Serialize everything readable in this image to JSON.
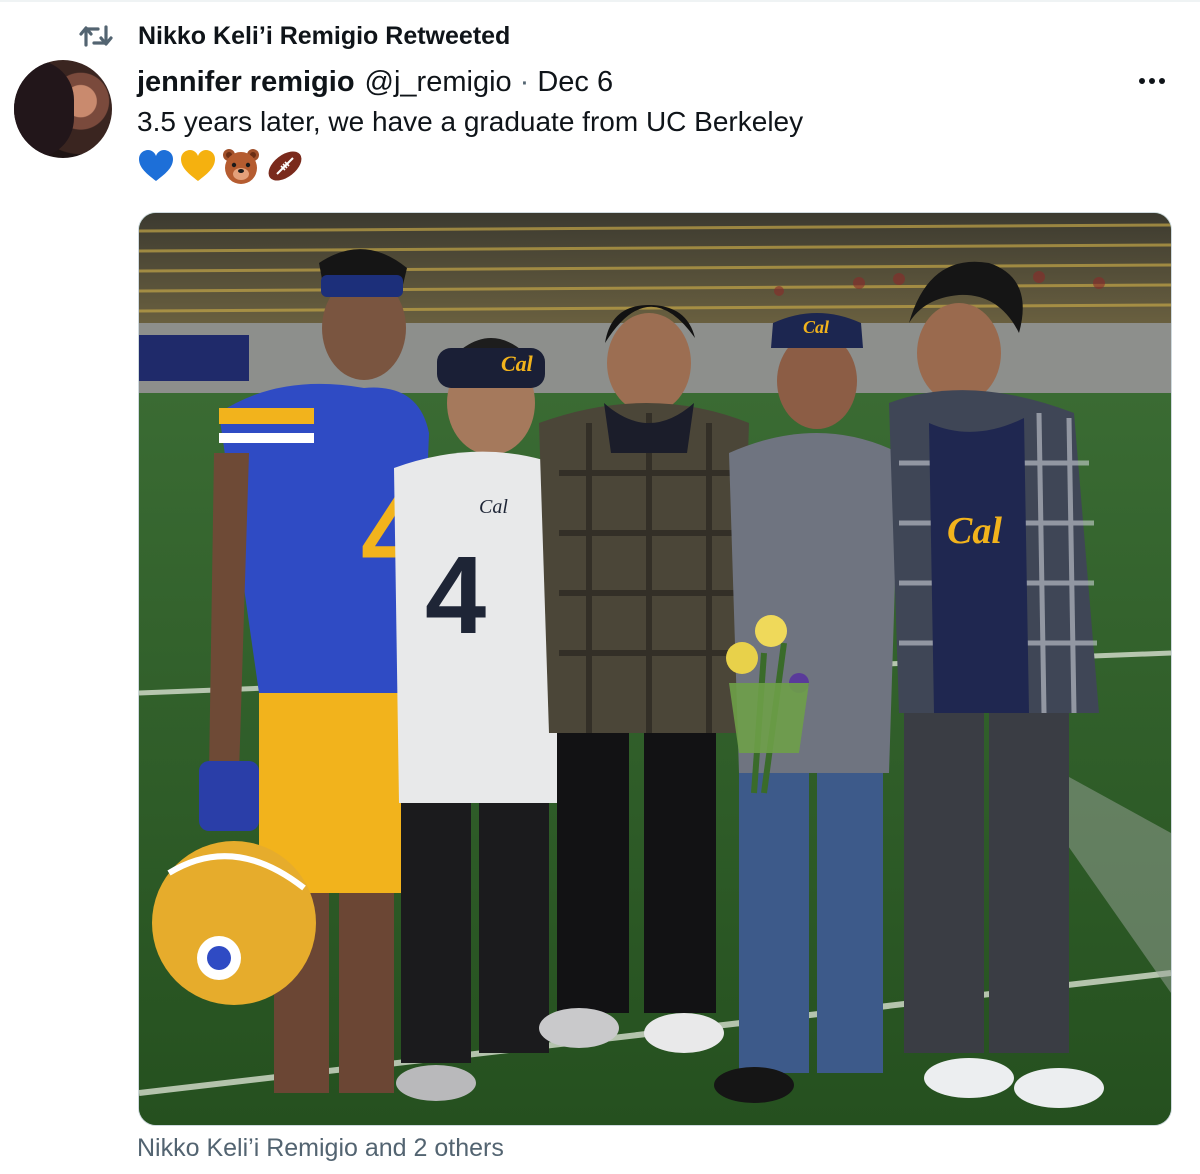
{
  "retweet": {
    "text": "Nikko Keli’i Remigio Retweeted",
    "icon": "retweet-icon"
  },
  "tweet": {
    "author_name": "jennifer remigio",
    "handle": "@j_remigio",
    "separator": "·",
    "date": "Dec 6",
    "text": "3.5 years later, we have a graduate from UC Berkeley",
    "emojis": [
      "blue-heart-emoji",
      "yellow-heart-emoji",
      "bear-face-emoji",
      "american-football-emoji"
    ],
    "more_icon": "more-horizontal-icon"
  },
  "media": {
    "jersey_number": "4",
    "team_wordmark": "Cal"
  },
  "tagged": "Nikko Keli’i Remigio and 2 others",
  "colors": {
    "text_primary": "#0f1419",
    "text_secondary": "#536471",
    "border": "#cfd9de",
    "cal_blue": "#2f4bc4",
    "cal_gold": "#f2b31c",
    "turf": "#2a5a28"
  }
}
